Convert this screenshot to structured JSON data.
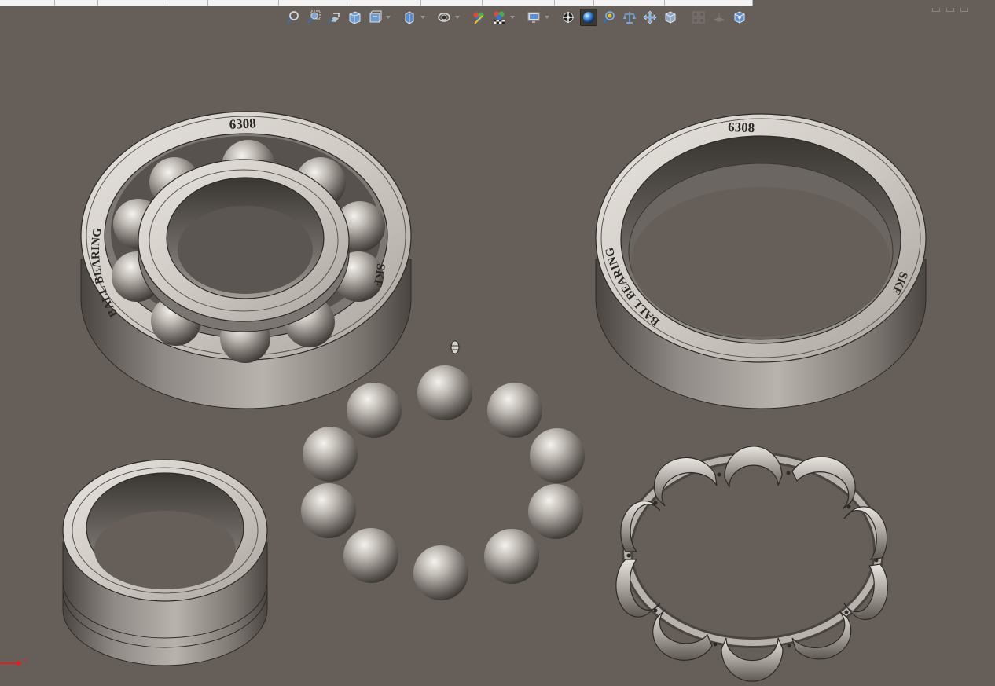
{
  "window": {
    "tabs": [
      "",
      "",
      "",
      "",
      "",
      "",
      "",
      "",
      "",
      "",
      "",
      "",
      ""
    ]
  },
  "toolbar": {
    "buttons": [
      {
        "id": "zoom-to-fit",
        "icon": "zoom-to-fit-icon"
      },
      {
        "id": "zoom-to-area",
        "icon": "zoom-to-area-icon"
      },
      {
        "id": "previous-view",
        "icon": "previous-view-icon"
      },
      {
        "id": "section-view",
        "icon": "section-view-icon"
      },
      {
        "id": "dynamic-annotation-views",
        "icon": "annotation-view-icon"
      },
      {
        "id": "view-orientation",
        "icon": "view-orientation-icon"
      },
      {
        "id": "display-style",
        "icon": "display-style-icon"
      },
      {
        "id": "hide-show-items",
        "icon": "hide-show-icon"
      },
      {
        "id": "edit-appearance",
        "icon": "edit-appearance-icon"
      },
      {
        "id": "apply-scene",
        "icon": "apply-scene-icon"
      },
      {
        "id": "view-settings",
        "icon": "view-settings-icon"
      },
      {
        "id": "rotate-view",
        "icon": "rotate-icon"
      },
      {
        "id": "shaded",
        "icon": "shaded-sphere-icon"
      },
      {
        "id": "measure",
        "icon": "measure-icon"
      },
      {
        "id": "mass-properties",
        "icon": "scale-icon"
      },
      {
        "id": "move-component",
        "icon": "move-icon"
      },
      {
        "id": "cube-view",
        "icon": "cube-icon"
      },
      {
        "id": "grid-view",
        "icon": "grid-icon"
      },
      {
        "id": "plane-view",
        "icon": "plane-icon"
      },
      {
        "id": "3d-box-view",
        "icon": "box-3d-icon"
      }
    ]
  },
  "model": {
    "assembly_outer_text": "6308",
    "assembly_side_text_left": "BALL BEARING",
    "assembly_side_text_right": "SKF",
    "outer_ring_text": "6308",
    "outer_ring_side_left": "BALL BEARING",
    "outer_ring_side_right": "SKF",
    "ball_count": 10
  },
  "colors": {
    "background": "#665f59",
    "metal_light": "#dcd8d3",
    "metal_mid": "#8e8883",
    "metal_dark": "#3e3a36",
    "active_button": "#3a3631",
    "triad_x": "#e02020"
  },
  "triad": {
    "axis_label": "x"
  }
}
